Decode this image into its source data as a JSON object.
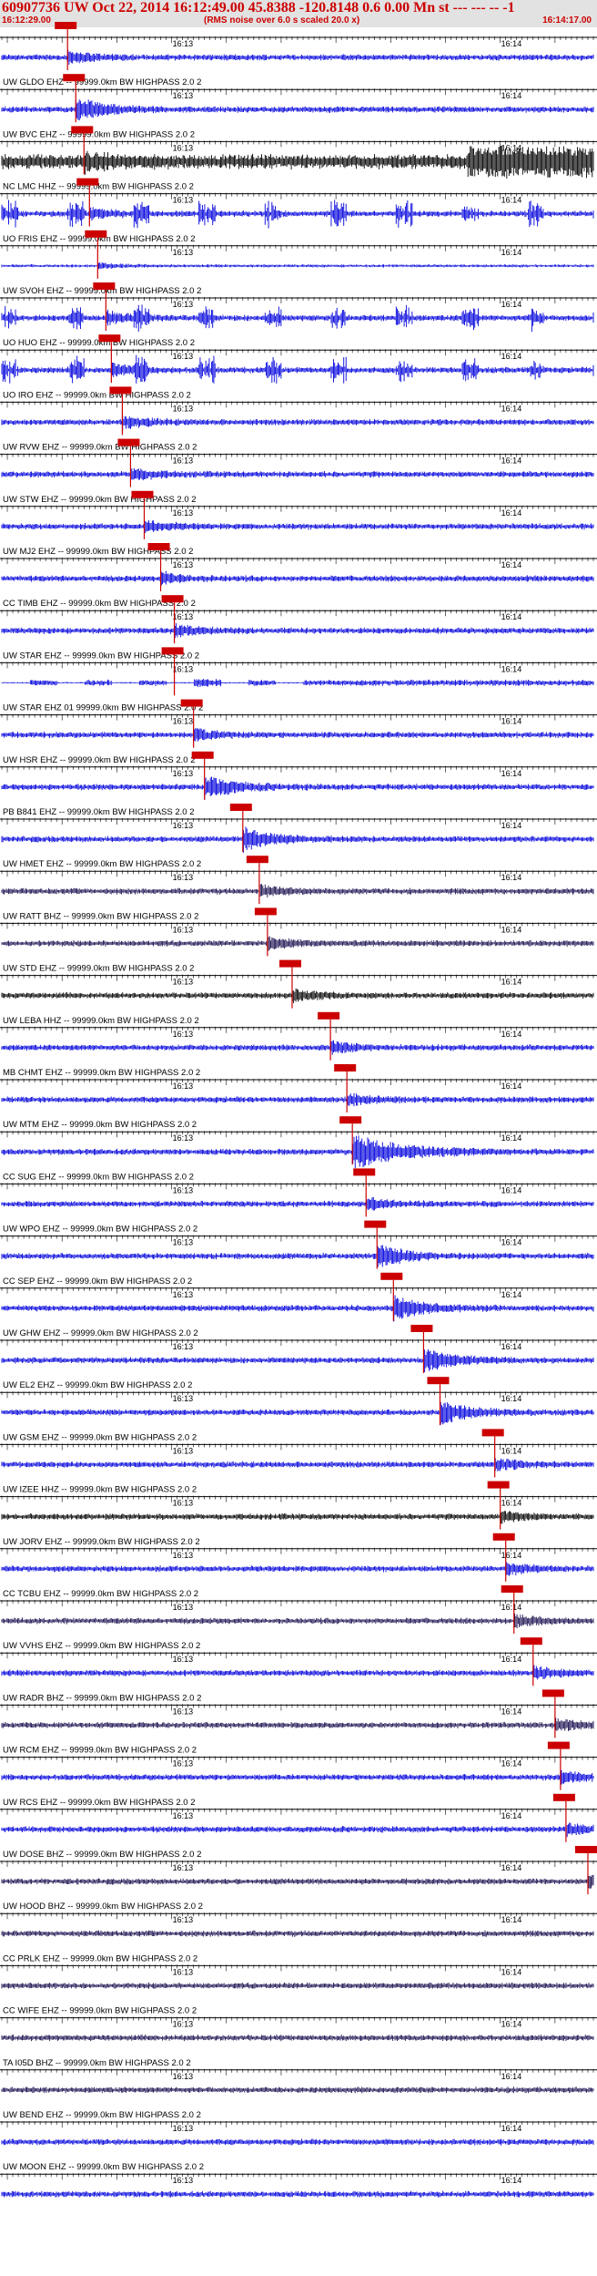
{
  "header": {
    "title": "60907736 UW Oct 22, 2014 16:12:49.00   45.8388 -120.8148  0.6 0.00 Mn st --- --- --  -1",
    "start_time": "16:12:29.00",
    "note": "(RMS noise over 6.0 s scaled 20.0 x)",
    "end_time": "16:14:17.00"
  },
  "colors": {
    "header_text": "#cc0000",
    "header_bg": "#e2e2e2",
    "trace_blue": "#0000dd",
    "trace_black": "#000000",
    "trace_navy": "#1a1050",
    "pick": "#cc0000"
  },
  "chart_data": {
    "type": "seismogram",
    "x_unit": "time (UTC)",
    "xlim": [
      "16:12:29.00",
      "16:14:17.00"
    ],
    "time_labels": [
      "16:13",
      "16:14"
    ],
    "time_label_seconds": [
      31,
      91
    ],
    "traces": [
      {
        "label": "",
        "color": "blue",
        "p_pick_s": 12.0,
        "event": "spike"
      },
      {
        "label": "UW GLDO EHZ -- 99999.0km BW  HIGHPASS  2.0  2",
        "color": "blue",
        "p_pick_s": 13.5,
        "event": "burst"
      },
      {
        "label": "UW BVC EHZ -- 99999.0km BW  HIGHPASS  2.0  2",
        "color": "black",
        "p_pick_s": 15.0,
        "event": "noisy"
      },
      {
        "label": "NC LMC HHZ -- 99999.0km BW  HIGHPASS  2.0  2",
        "color": "blue",
        "p_pick_s": 16.0,
        "event": "spiky"
      },
      {
        "label": "UO FRIS EHZ -- 99999.0km BW  HIGHPASS  2.0  2",
        "color": "blue",
        "p_pick_s": 17.5,
        "event": "quiet"
      },
      {
        "label": "UW SVOH EHZ -- 99999.0km BW  HIGHPASS  2.0  2",
        "color": "blue",
        "p_pick_s": 19.0,
        "event": "spiky"
      },
      {
        "label": "UO HUO EHZ -- 99999.0km BW  HIGHPASS  2.0  2",
        "color": "blue",
        "p_pick_s": 20.0,
        "event": "spiky"
      },
      {
        "label": "UO IRO EHZ -- 99999.0km BW  HIGHPASS  2.0  2",
        "color": "blue",
        "p_pick_s": 22.0,
        "event": "normal"
      },
      {
        "label": "UW RVW EHZ -- 99999.0km BW  HIGHPASS  2.0  2",
        "color": "blue",
        "p_pick_s": 23.5,
        "event": "normal"
      },
      {
        "label": "UW STW EHZ -- 99999.0km BW  HIGHPASS  2.0  2",
        "color": "blue",
        "p_pick_s": 26.0,
        "event": "normal"
      },
      {
        "label": "UW MJ2 EHZ -- 99999.0km BW  HIGHPASS  2.0  2",
        "color": "blue",
        "p_pick_s": 29.0,
        "event": "normal"
      },
      {
        "label": "CC TIMB EHZ -- 99999.0km BW  HIGHPASS  2.0  2",
        "color": "blue",
        "p_pick_s": 31.5,
        "event": "normal"
      },
      {
        "label": "UW STAR EHZ -- 99999.0km BW  HIGHPASS  2.0  2",
        "color": "blue",
        "p_pick_s": 31.5,
        "event": "gappy"
      },
      {
        "label": "UW STAR EHZ 01 99999.0km BW  HIGHPASS  2.0  2",
        "color": "blue",
        "p_pick_s": 35.0,
        "event": "normal"
      },
      {
        "label": "UW HSR EHZ -- 99999.0km BW  HIGHPASS  2.0  2",
        "color": "blue",
        "p_pick_s": 37.0,
        "event": "burst"
      },
      {
        "label": "PB B841 EHZ -- 99999.0km BW  HIGHPASS  2.0  2",
        "color": "blue",
        "p_pick_s": 44.0,
        "event": "burst"
      },
      {
        "label": "UW HMET EHZ -- 99999.0km BW  HIGHPASS  2.0  2",
        "color": "navy",
        "p_pick_s": 47.0,
        "event": "normal"
      },
      {
        "label": "UW RATT BHZ -- 99999.0km BW  HIGHPASS  2.0  2",
        "color": "navy",
        "p_pick_s": 48.5,
        "event": "normal"
      },
      {
        "label": "UW STD EHZ -- 99999.0km BW  HIGHPASS  2.0  2",
        "color": "black",
        "p_pick_s": 53.0,
        "event": "normal"
      },
      {
        "label": "UW LEBA HHZ -- 99999.0km BW  HIGHPASS  2.0  2",
        "color": "blue",
        "p_pick_s": 60.0,
        "event": "normal"
      },
      {
        "label": "MB CHMT EHZ -- 99999.0km BW  HIGHPASS  2.0  2",
        "color": "blue",
        "p_pick_s": 63.0,
        "event": "normal"
      },
      {
        "label": "UW MTM EHZ -- 99999.0km BW  HIGHPASS  2.0  2",
        "color": "blue",
        "p_pick_s": 64.0,
        "event": "big"
      },
      {
        "label": "CC SUG EHZ -- 99999.0km BW  HIGHPASS  2.0  2",
        "color": "blue",
        "p_pick_s": 66.5,
        "event": "normal"
      },
      {
        "label": "UW WPO EHZ -- 99999.0km BW  HIGHPASS  2.0  2",
        "color": "blue",
        "p_pick_s": 68.5,
        "event": "burst"
      },
      {
        "label": "CC SEP EHZ -- 99999.0km BW  HIGHPASS  2.0  2",
        "color": "blue",
        "p_pick_s": 71.5,
        "event": "burst"
      },
      {
        "label": "UW GHW EHZ -- 99999.0km BW  HIGHPASS  2.0  2",
        "color": "blue",
        "p_pick_s": 77.0,
        "event": "burst"
      },
      {
        "label": "UW EL2 EHZ -- 99999.0km BW  HIGHPASS  2.0  2",
        "color": "blue",
        "p_pick_s": 80.0,
        "event": "burst"
      },
      {
        "label": "UW GSM EHZ -- 99999.0km BW  HIGHPASS  2.0  2",
        "color": "blue",
        "p_pick_s": 90.0,
        "event": "normal"
      },
      {
        "label": "UW IZEE HHZ -- 99999.0km BW  HIGHPASS  2.0  2",
        "color": "black",
        "p_pick_s": 91.0,
        "event": "normal"
      },
      {
        "label": "UW JORV EHZ -- 99999.0km BW  HIGHPASS  2.0  2",
        "color": "blue",
        "p_pick_s": 92.0,
        "event": "normal"
      },
      {
        "label": "CC TCBU EHZ -- 99999.0km BW  HIGHPASS  2.0  2",
        "color": "navy",
        "p_pick_s": 93.5,
        "event": "normal"
      },
      {
        "label": "UW VVHS EHZ -- 99999.0km BW  HIGHPASS  2.0  2",
        "color": "blue",
        "p_pick_s": 97.0,
        "event": "normal"
      },
      {
        "label": "UW RADR BHZ -- 99999.0km BW  HIGHPASS  2.0  2",
        "color": "navy",
        "p_pick_s": 101.0,
        "event": "normal"
      },
      {
        "label": "UW RCM EHZ -- 99999.0km BW  HIGHPASS  2.0  2",
        "color": "blue",
        "p_pick_s": 102.0,
        "event": "normal"
      },
      {
        "label": "UW RCS EHZ -- 99999.0km BW  HIGHPASS  2.0  2",
        "color": "blue",
        "p_pick_s": 103.0,
        "event": "normal"
      },
      {
        "label": "UW DOSE BHZ -- 99999.0km BW  HIGHPASS  2.0  2",
        "color": "navy",
        "p_pick_s": 107.0,
        "event": "normal"
      },
      {
        "label": "UW HOOD BHZ -- 99999.0km BW  HIGHPASS  2.0  2",
        "color": "navy",
        "p_pick_s": null,
        "event": "normal"
      },
      {
        "label": "CC PRLK EHZ -- 99999.0km BW  HIGHPASS  2.0  2",
        "color": "navy",
        "p_pick_s": null,
        "event": "normal"
      },
      {
        "label": "CC WIFE EHZ -- 99999.0km BW  HIGHPASS  2.0  2",
        "color": "navy",
        "p_pick_s": null,
        "event": "normal"
      },
      {
        "label": "TA I05D BHZ -- 99999.0km BW  HIGHPASS  2.0  2",
        "color": "navy",
        "p_pick_s": null,
        "event": "normal"
      },
      {
        "label": "UW BEND EHZ -- 99999.0km BW  HIGHPASS  2.0  2",
        "color": "blue",
        "p_pick_s": null,
        "event": "normal"
      },
      {
        "label": "UW MOON EHZ -- 99999.0km BW  HIGHPASS  2.0  2",
        "color": "blue",
        "p_pick_s": null,
        "event": "normal"
      }
    ]
  }
}
